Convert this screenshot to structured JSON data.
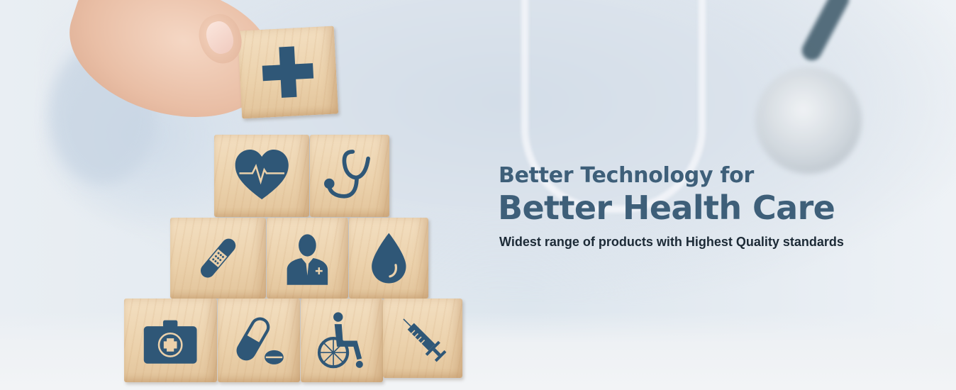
{
  "hero": {
    "headline_line1": "Better Technology for",
    "headline_line2": "Better Health Care",
    "subheading": "Widest range of products with Highest Quality standards"
  },
  "blocks": {
    "top": "plus-icon",
    "row2": [
      "heart-pulse-icon",
      "stethoscope-icon"
    ],
    "row3": [
      "bandage-icon",
      "doctor-icon",
      "blood-drop-icon"
    ],
    "row4": [
      "first-aid-kit-icon",
      "pill-icon",
      "wheelchair-icon",
      "syringe-icon"
    ]
  },
  "colors": {
    "headline": "#3e5f79",
    "subheading": "#1c2a36",
    "icon": "#2f5777",
    "wood": "#ebd1ab"
  }
}
